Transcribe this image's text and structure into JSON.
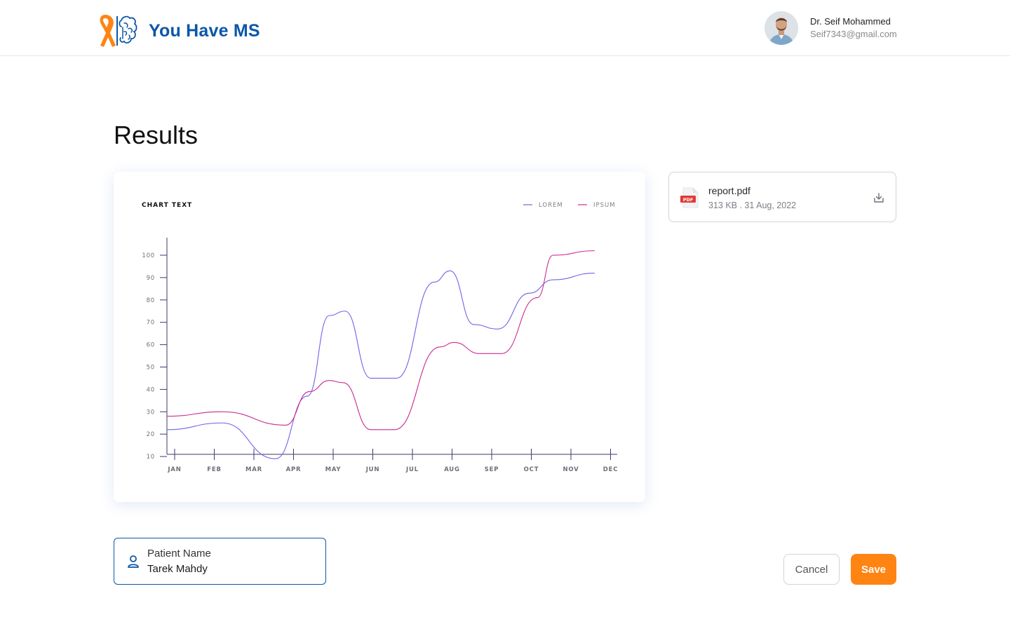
{
  "header": {
    "brand": "You Have MS",
    "user": {
      "name": "Dr. Seif Mohammed",
      "email": "Seif7343@gmail.com"
    }
  },
  "page": {
    "title": "Results"
  },
  "chart_data": {
    "type": "line",
    "title": "CHART TEXT",
    "categories": [
      "JAN",
      "FEB",
      "MAR",
      "APR",
      "MAY",
      "JUN",
      "JUL",
      "AUG",
      "SEP",
      "OCT",
      "NOV",
      "DEC"
    ],
    "y_ticks": [
      10,
      20,
      30,
      40,
      50,
      60,
      70,
      80,
      90,
      100
    ],
    "ylim": [
      0,
      100
    ],
    "legend_position": "top-right",
    "grid": false,
    "series": [
      {
        "name": "LOREM",
        "color": "#6f63e6",
        "points": [
          [
            -0.2,
            22
          ],
          [
            1.2,
            25
          ],
          [
            2.55,
            9
          ],
          [
            3.35,
            37
          ],
          [
            3.9,
            73
          ],
          [
            4.3,
            75
          ],
          [
            4.95,
            45
          ],
          [
            5.6,
            45
          ],
          [
            6.55,
            88
          ],
          [
            6.95,
            93
          ],
          [
            7.55,
            69
          ],
          [
            8.15,
            67
          ],
          [
            8.95,
            83
          ],
          [
            9.55,
            89
          ],
          [
            10.6,
            92
          ]
        ]
      },
      {
        "name": "IPSUM",
        "color": "#cc2a8f",
        "points": [
          [
            -0.2,
            28
          ],
          [
            1.2,
            30
          ],
          [
            2.8,
            24
          ],
          [
            3.4,
            39
          ],
          [
            3.9,
            44
          ],
          [
            4.25,
            43
          ],
          [
            4.95,
            22
          ],
          [
            5.55,
            22
          ],
          [
            6.7,
            59
          ],
          [
            7.05,
            61
          ],
          [
            7.7,
            56
          ],
          [
            8.25,
            56
          ],
          [
            9.15,
            81
          ],
          [
            9.55,
            100
          ],
          [
            10.6,
            102
          ]
        ]
      }
    ]
  },
  "file": {
    "name": "report.pdf",
    "meta": "313 KB . 31 Aug, 2022",
    "badge": "PDF"
  },
  "patient": {
    "label": "Patient Name",
    "value": "Tarek Mahdy"
  },
  "actions": {
    "cancel": "Cancel",
    "save": "Save"
  },
  "colors": {
    "brand_blue": "#0a57a8",
    "accent_orange": "#ff8412"
  }
}
